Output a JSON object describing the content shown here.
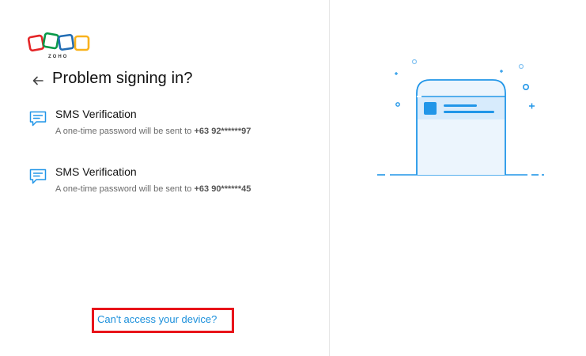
{
  "brand": {
    "logo_text": "ZOHO"
  },
  "header": {
    "title": "Problem signing in?"
  },
  "options": [
    {
      "title": "SMS Verification",
      "desc_prefix": "A one-time password will be sent to ",
      "phone": "+63 92******97"
    },
    {
      "title": "SMS Verification",
      "desc_prefix": "A one-time password will be sent to ",
      "phone": "+63 90******45"
    }
  ],
  "footer": {
    "cant_access_link": "Can't access your device?"
  },
  "colors": {
    "accent": "#1a8fdb",
    "highlight_box": "#e8141a",
    "illustration": "#2196e8"
  }
}
